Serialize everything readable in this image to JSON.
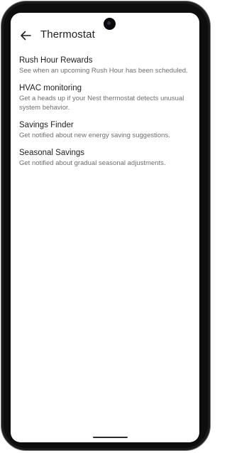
{
  "app_bar": {
    "title": "Thermostat",
    "back_icon": "arrow-left-icon",
    "overflow_icon": "more-vert-icon"
  },
  "settings": [
    {
      "title": "Rush Hour Rewards",
      "subtitle": "See when an upcoming Rush Hour has been scheduled."
    },
    {
      "title": "HVAC monitoring",
      "subtitle": "Get a heads up if your Nest thermostat detects unusual system behavior."
    },
    {
      "title": "Savings Finder",
      "subtitle": "Get notified about new energy saving suggestions."
    },
    {
      "title": "Seasonal Savings",
      "subtitle": "Get notified about gradual seasonal adjustments."
    }
  ],
  "colors": {
    "text_primary": "#202124",
    "text_secondary": "#6f6f6f",
    "background": "#ffffff"
  }
}
